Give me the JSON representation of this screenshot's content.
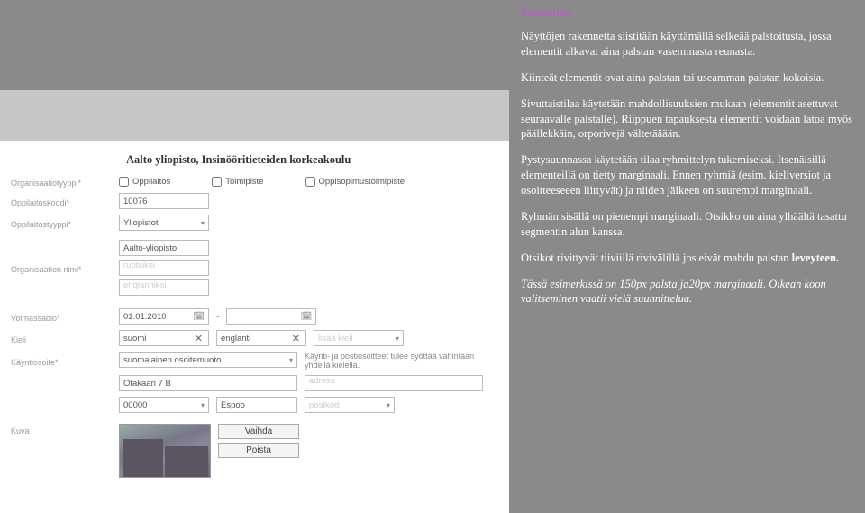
{
  "sidebar": {
    "title": "Palstoitus",
    "p1": "Näyttöjen rakennetta siistitään käyttämällä selkeää palstoitusta, jossa elementit alkavat aina palstan vasemmasta reunasta.",
    "p2": "Kiinteät elementit ovat aina palstan tai useamman palstan kokoisia.",
    "p3": "Sivuttaistilaa käytetään mahdollisuuksien mukaan (elementit asettuvat seuraavalle palstalle). Riippuen tapauksesta elementit voidaan latoa myös päällekkäin, orporivejä vältetääään.",
    "p4": "Pystysuunnassa käytetään tilaa ryhmittelyn tukemiseksi. Itsenäisillä elementeillä on tietty marginaali. Ennen ryhmiä (esim. kieliversiot ja osoitteeseeen liittyvät) ja niiden jälkeen on suurempi marginaali.",
    "p5a": "Ryhmän sisällä on pienempi marginaali. Otsikko on aina ylhäältä tasattu segmentin alun kanssa.",
    "p6a": "Otsikot rivittyvät tiiviillä rivivälillä jos eivät mahdu palstan ",
    "p6b": "leveyteen.",
    "p7": "Tässä esimerkissä on 150px palsta ja20px marginaali. Oikean koon valitseminen vaatii vielä suunnittelua."
  },
  "form": {
    "title": "Aalto yliopisto, Insinööritieteiden korkeakoulu",
    "labels": {
      "orgtype": "Organisaatiotyyppi*",
      "code": "Oppilaitoskoodi*",
      "insttype": "Oppilaitostyyppi*",
      "orgname": "Organisaation nimi*",
      "valid": "Voimassaolo*",
      "lang": "Kieli",
      "address": "Käyntiosoite*",
      "image": "Kuva"
    },
    "radios": {
      "r1": "Oppilaitos",
      "r2": "Toimipiste",
      "r3": "Oppisopimustoimipiste"
    },
    "values": {
      "code": "10076",
      "insttype": "Yliopistot",
      "name_fi": "Aalto-yliopisto",
      "name_sv_ph": "ruotsiksi",
      "name_en_ph": "englanniksi",
      "valid_from": "01.01.2010",
      "valid_sep": "-",
      "lang1": "suomi",
      "lang2": "englanti",
      "addlang_ph": "lisää kieli",
      "addrform": "suomalainen osoitemuoto",
      "addr_note": "Käynti- ja postiosoitteet tulee syöttää vähintään yhdellä kielellä.",
      "street": "Otakaari 7 B",
      "street2_ph": "adress",
      "zip": "00000",
      "city": "Espoo",
      "zip2_ph": "postkod"
    },
    "buttons": {
      "change": "Vaihda",
      "remove": "Poista"
    }
  }
}
